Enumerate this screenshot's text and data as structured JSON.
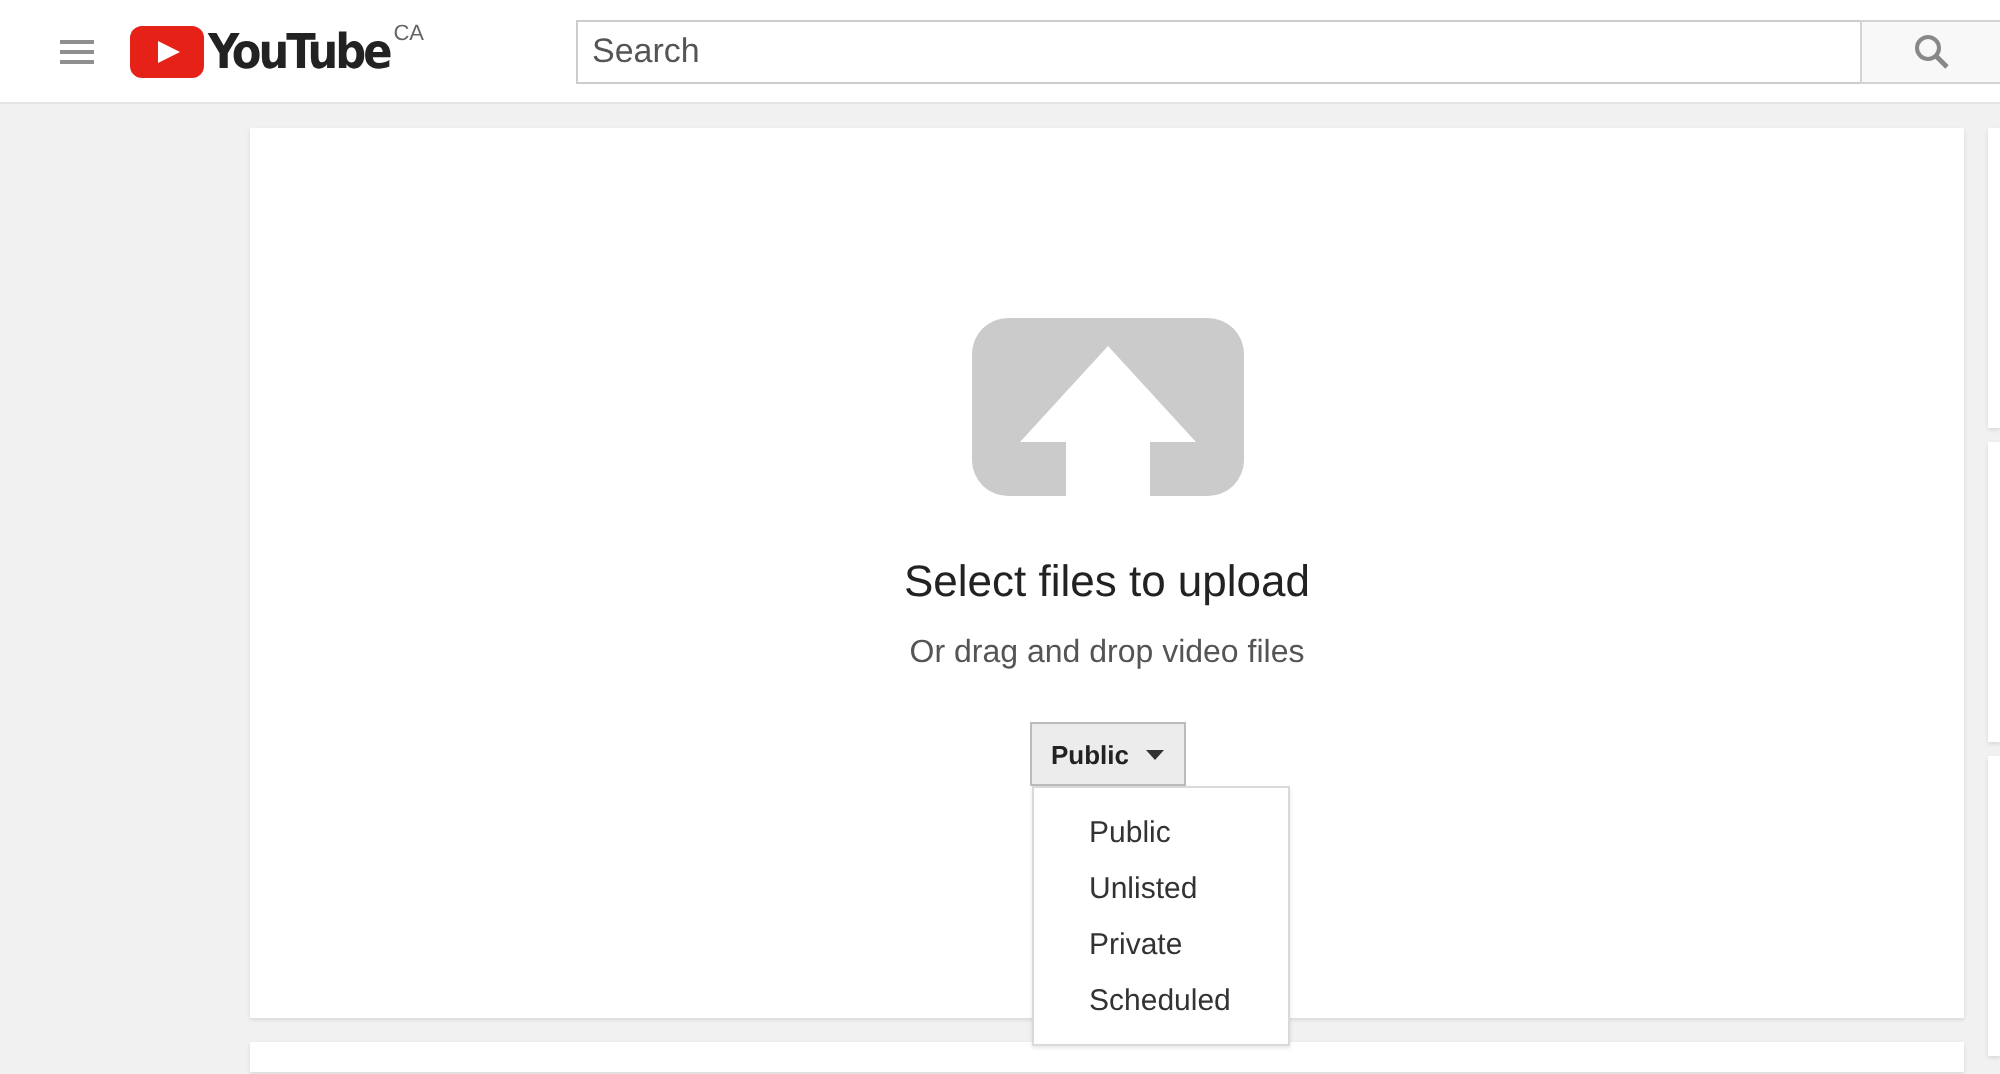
{
  "header": {
    "logo_text": "YouTube",
    "region": "CA",
    "search": {
      "placeholder": "Search"
    }
  },
  "upload": {
    "title": "Select files to upload",
    "subtitle": "Or drag and drop video files",
    "privacy": {
      "value": "Public",
      "expanded": true,
      "options": [
        "Public",
        "Unlisted",
        "Private",
        "Scheduled"
      ]
    }
  }
}
